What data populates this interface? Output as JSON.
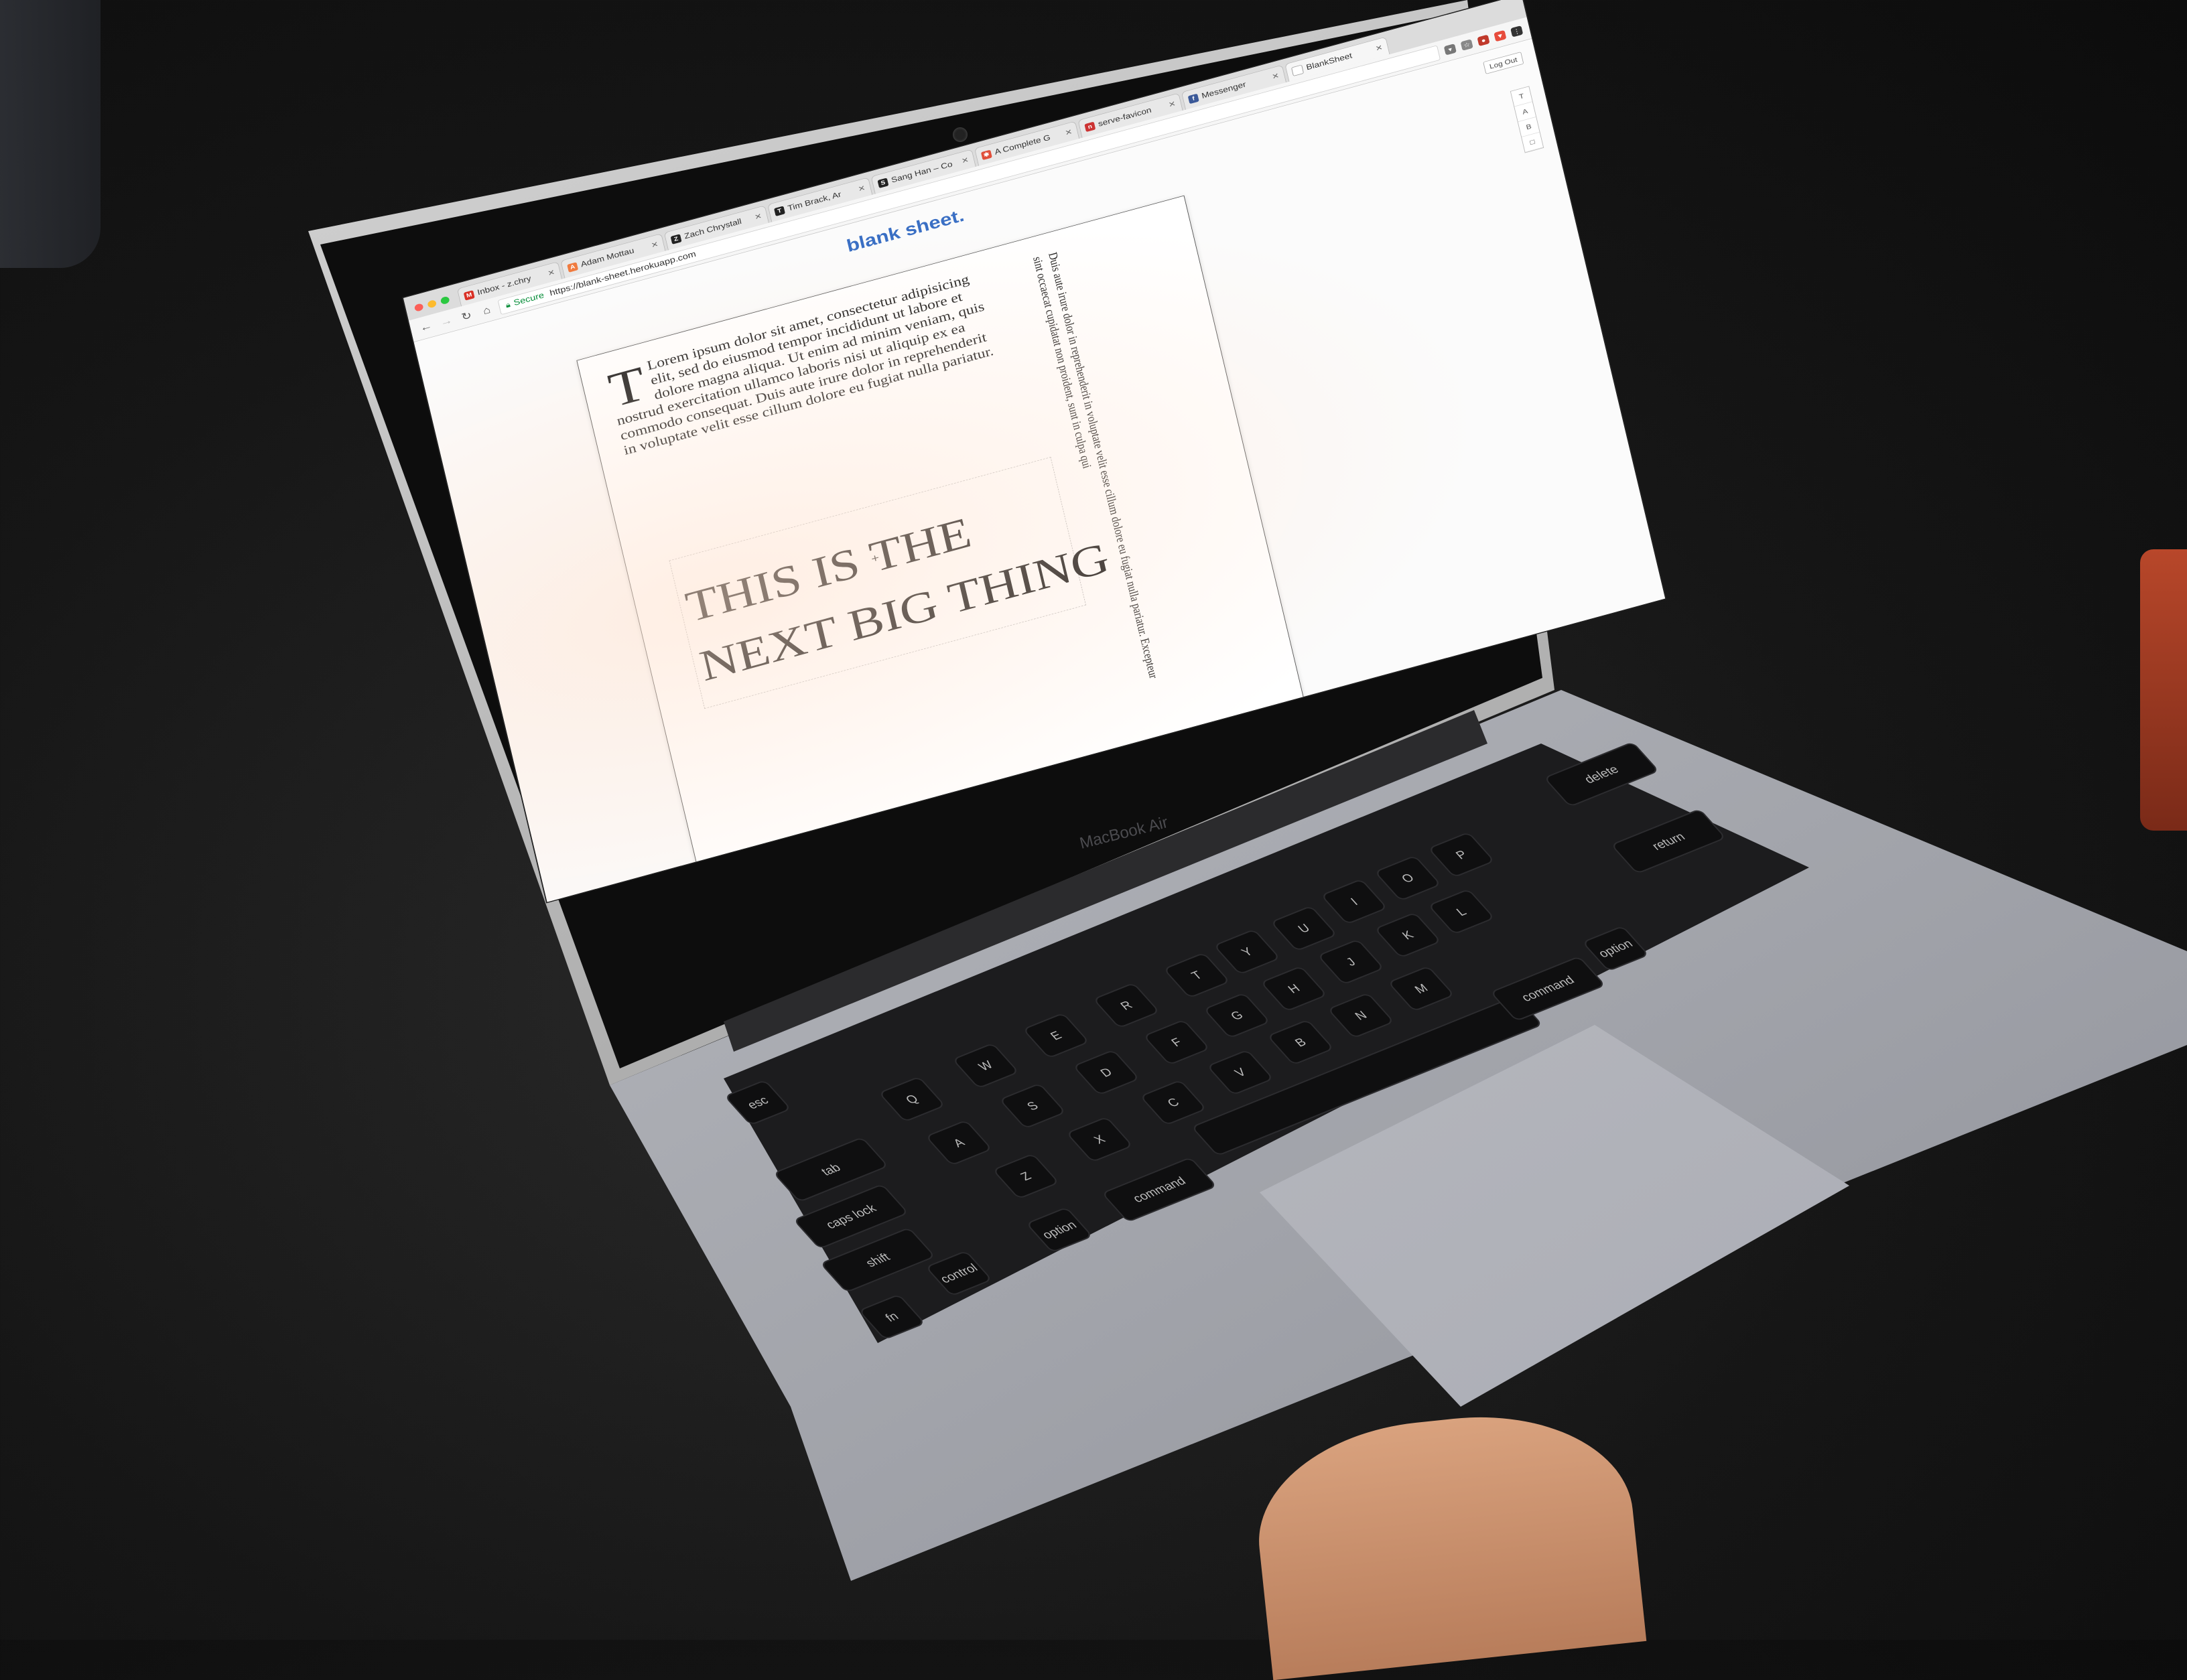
{
  "browser": {
    "tabs": [
      {
        "label": "Inbox - z.chry",
        "favicon_color": "#d93025",
        "favicon_glyph": "M",
        "active": false
      },
      {
        "label": "Adam Mottau",
        "favicon_color": "#f07b3f",
        "favicon_glyph": "A",
        "active": false
      },
      {
        "label": "Zach Chrystall",
        "favicon_color": "#222222",
        "favicon_glyph": "Z",
        "active": false
      },
      {
        "label": "Tim Brack, Ar",
        "favicon_color": "#222222",
        "favicon_glyph": "T",
        "active": false
      },
      {
        "label": "Sang Han – Co",
        "favicon_color": "#222222",
        "favicon_glyph": "S",
        "active": false
      },
      {
        "label": "A Complete G",
        "favicon_color": "#e04e39",
        "favicon_glyph": "✱",
        "active": false
      },
      {
        "label": "serve-favicon",
        "favicon_color": "#cc3333",
        "favicon_glyph": "n",
        "active": false
      },
      {
        "label": "Messenger",
        "favicon_color": "#3b5998",
        "favicon_glyph": "f",
        "active": false
      },
      {
        "label": "BlankSheet",
        "favicon_color": "#ffffff",
        "favicon_glyph": "",
        "active": true
      }
    ],
    "secure_label": "Secure",
    "url": "https://blank-sheet.herokuapp.com"
  },
  "app": {
    "brand": "blank sheet.",
    "logout_label": "Log Out",
    "tools": [
      "T",
      "A",
      "B",
      "□"
    ]
  },
  "sheet": {
    "dropcap": "T",
    "paragraph": "Lorem ipsum dolor sit amet, consectetur adipisicing elit, sed do eiusmod tempor incididunt ut labore et dolore magna aliqua. Ut enim ad minim veniam, quis nostrud exercitation ullamco laboris nisi ut aliquip ex ea commodo consequat. Duis aute irure dolor in reprehenderit in voluptate velit esse cillum dolore eu fugiat nulla pariatur.",
    "vertical_text": "Duis aute irure dolor in reprehenderit in voluptate velit esse cillum dolore eu fugiat nulla pariatur. Excepteur sint occaecat cupidatat non proident, sunt in culpa qui",
    "headline_line1": "THIS IS THE",
    "headline_line2": "NEXT BIG THING"
  },
  "laptop": {
    "model": "MacBook Air"
  },
  "keys": {
    "esc": "esc",
    "tab": "tab",
    "caps": "caps lock",
    "shift": "shift",
    "fn": "fn",
    "control": "control",
    "option": "option",
    "command": "command",
    "delete": "delete",
    "return": "return",
    "letters": [
      "Q",
      "W",
      "E",
      "R",
      "T",
      "Y",
      "U",
      "I",
      "O",
      "P",
      "A",
      "S",
      "D",
      "F",
      "G",
      "H",
      "J",
      "K",
      "L",
      "Z",
      "X",
      "C",
      "V",
      "B",
      "N",
      "M"
    ]
  }
}
